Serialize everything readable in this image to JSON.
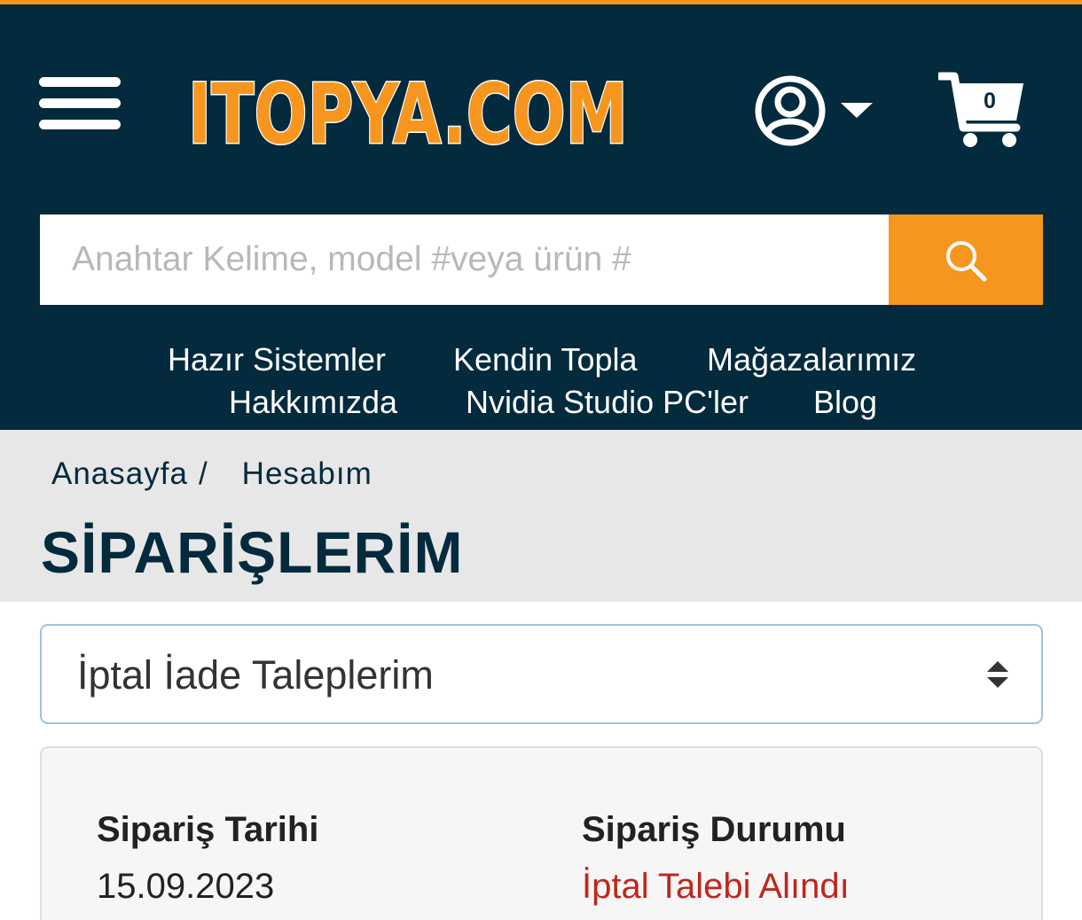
{
  "header": {
    "logo_text": "ITOPYA.COM",
    "cart_count": "0"
  },
  "search": {
    "placeholder": "Anahtar Kelime, model #veya ürün #"
  },
  "nav": {
    "items": [
      {
        "label": "Hazır Sistemler"
      },
      {
        "label": "Kendin Topla"
      },
      {
        "label": "Mağazalarımız"
      },
      {
        "label": "Hakkımızda"
      },
      {
        "label": "Nvidia Studio PC'ler"
      },
      {
        "label": "Blog"
      }
    ]
  },
  "breadcrumb": {
    "home": "Anasayfa",
    "separator": "/",
    "current": "Hesabım"
  },
  "page": {
    "title": "SİPARİŞLERİM"
  },
  "filter": {
    "selected": "İptal İade Taleplerim"
  },
  "order": {
    "date_label": "Sipariş Tarihi",
    "date_value": "15.09.2023",
    "status_label": "Sipariş Durumu",
    "status_value": "İptal Talebi Alındı"
  },
  "colors": {
    "header_bg": "#042a3d",
    "accent_orange": "#f7961f",
    "status_red": "#c0261c"
  }
}
